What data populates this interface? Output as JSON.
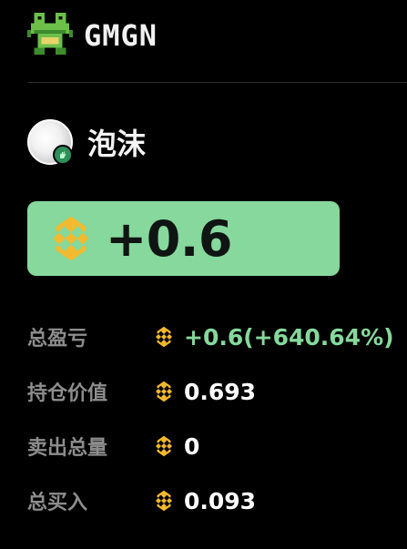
{
  "header": {
    "brand": "GMGN",
    "logo_icon": "frog-logo-icon"
  },
  "token": {
    "name": "泡沫",
    "avatar_icon": "bubble-avatar-icon",
    "badge_icon": "hand-badge-icon"
  },
  "pnl_card": {
    "value": "+0.6",
    "currency_icon": "bnb-coin-icon",
    "background": "#86d89c"
  },
  "stats": [
    {
      "label": "总盈亏",
      "value": "+0.6(+640.64%)",
      "positive": true
    },
    {
      "label": "持仓价值",
      "value": "0.693",
      "positive": false
    },
    {
      "label": "卖出总量",
      "value": "0",
      "positive": false
    },
    {
      "label": "总买入",
      "value": "0.093",
      "positive": false
    }
  ],
  "colors": {
    "accent_green": "#86d89c",
    "bnb_gold": "#f3ba2f",
    "label_gray": "#8d8d8d"
  }
}
